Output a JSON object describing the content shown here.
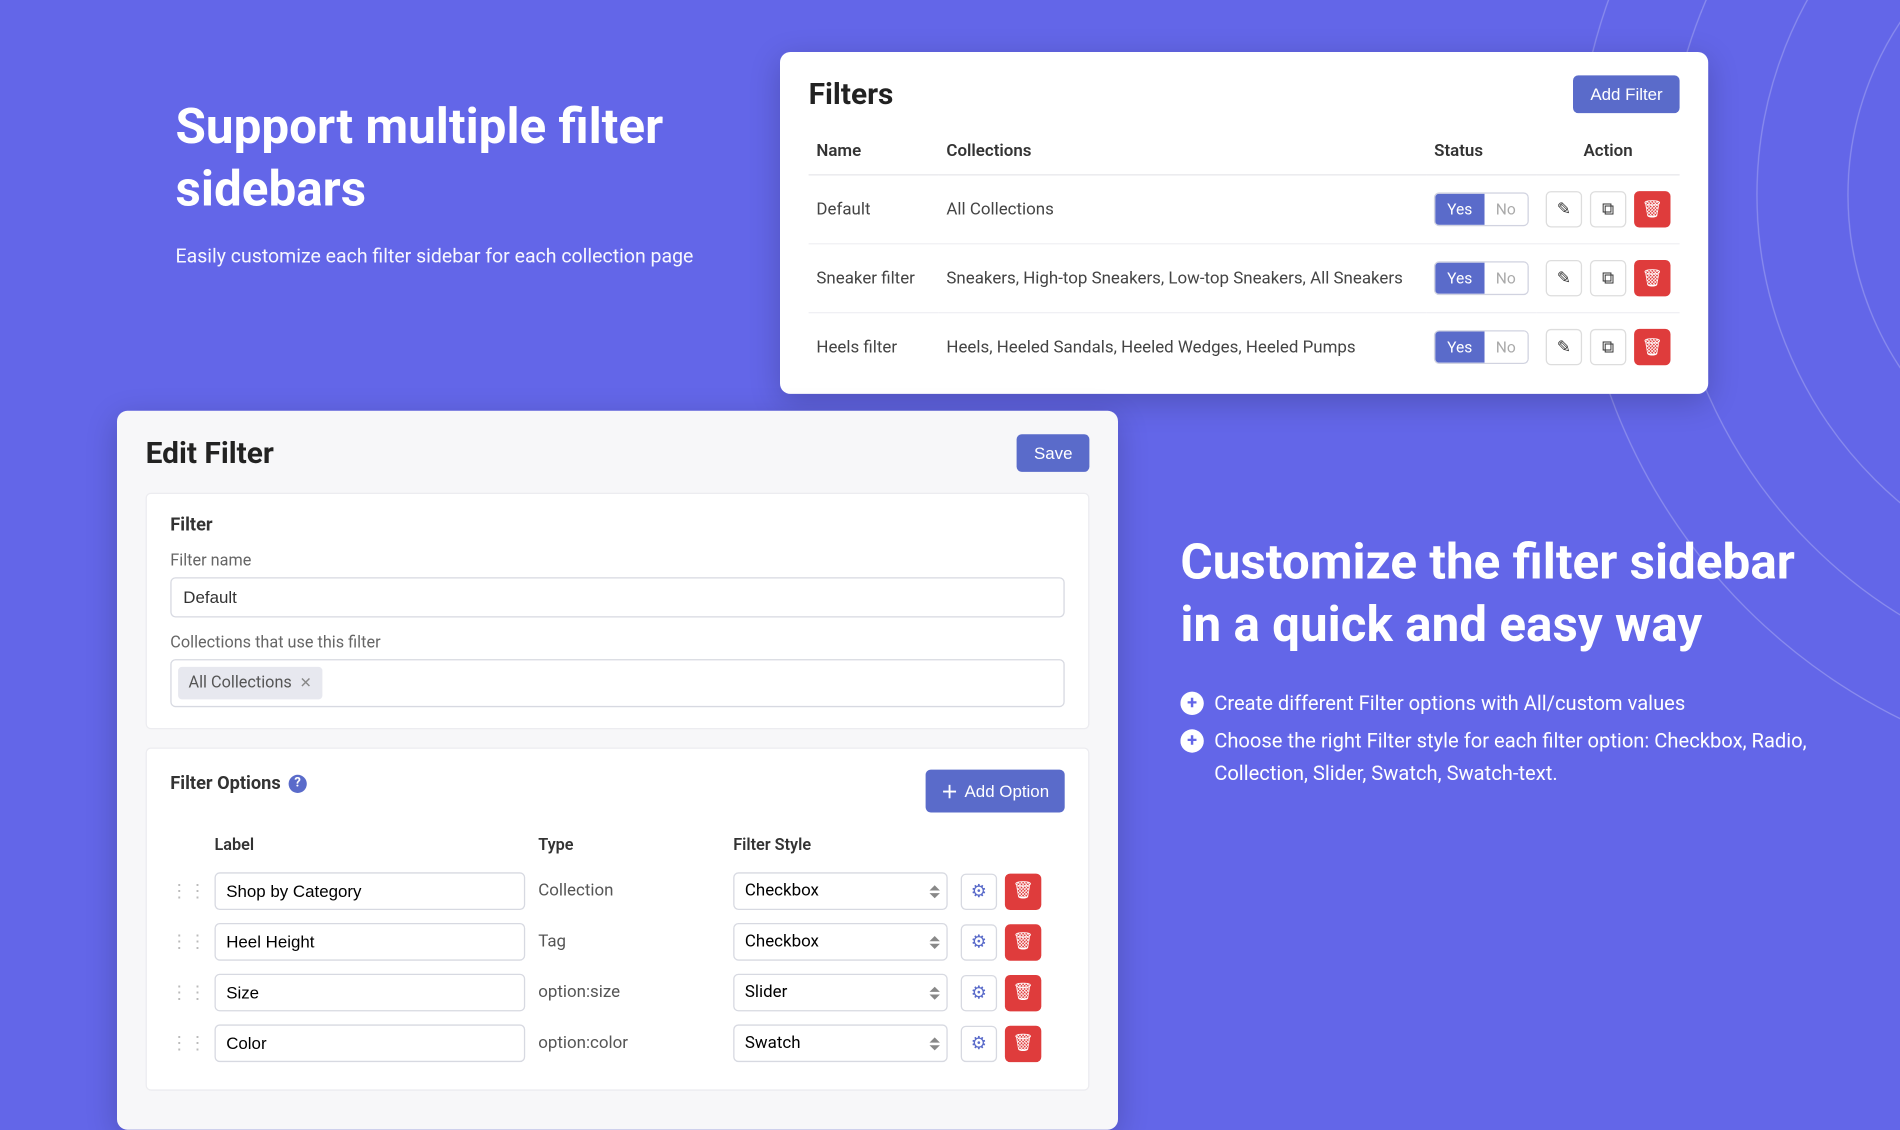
{
  "hero1": {
    "title": "Support multiple filter sidebars",
    "subtitle": "Easily customize each filter sidebar for each collection page"
  },
  "hero2": {
    "title": "Customize the filter sidebar in a quick and easy way",
    "bullets": [
      "Create different Filter options with All/custom values",
      "Choose the right Filter style for each filter option: Checkbox, Radio, Collection, Slider, Swatch, Swatch-text."
    ]
  },
  "filters": {
    "title": "Filters",
    "addBtn": "Add Filter",
    "cols": {
      "name": "Name",
      "collections": "Collections",
      "status": "Status",
      "action": "Action"
    },
    "toggle": {
      "yes": "Yes",
      "no": "No"
    },
    "rows": [
      {
        "name": "Default",
        "collections": "All Collections"
      },
      {
        "name": "Sneaker filter",
        "collections": "Sneakers, High-top Sneakers, Low-top Sneakers, All Sneakers"
      },
      {
        "name": "Heels filter",
        "collections": "Heels, Heeled Sandals, Heeled Wedges, Heeled Pumps"
      }
    ]
  },
  "edit": {
    "title": "Edit Filter",
    "saveBtn": "Save",
    "filterPanel": {
      "heading": "Filter",
      "nameLabel": "Filter name",
      "nameValue": "Default",
      "collectionsLabel": "Collections that use this filter",
      "collectionTag": "All Collections"
    },
    "optionsPanel": {
      "heading": "Filter Options",
      "addBtn": "Add Option",
      "cols": {
        "label": "Label",
        "type": "Type",
        "style": "Filter Style"
      },
      "rows": [
        {
          "label": "Shop by Category",
          "type": "Collection",
          "style": "Checkbox"
        },
        {
          "label": "Heel Height",
          "type": "Tag",
          "style": "Checkbox"
        },
        {
          "label": "Size",
          "type": "option:size",
          "style": "Slider"
        },
        {
          "label": "Color",
          "type": "option:color",
          "style": "Swatch"
        }
      ]
    }
  }
}
